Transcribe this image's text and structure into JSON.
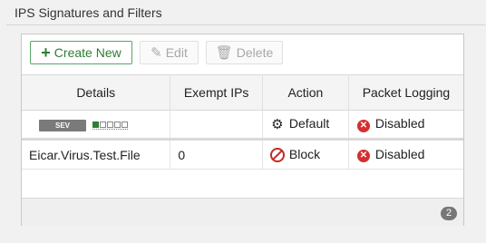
{
  "section": {
    "title": "IPS Signatures and Filters"
  },
  "toolbar": {
    "create_label": "Create New",
    "edit_label": "Edit",
    "delete_label": "Delete"
  },
  "table": {
    "headers": [
      "Details",
      "Exempt IPs",
      "Action",
      "Packet Logging"
    ],
    "sev_row": {
      "badge": "SEV",
      "severity_level": 1,
      "severity_max": 5,
      "action": "Default",
      "action_icon": "gear-icon",
      "logging": "Disabled",
      "logging_icon": "x-circle-icon"
    },
    "rows": [
      {
        "details": "Eicar.Virus.Test.File",
        "exempt_ips": "0",
        "action": "Block",
        "action_icon": "block-icon",
        "logging": "Disabled",
        "logging_icon": "x-circle-icon"
      }
    ]
  },
  "footer": {
    "count": "2"
  },
  "colors": {
    "accent_green": "#2e7d32",
    "danger_red": "#d32f2f"
  }
}
